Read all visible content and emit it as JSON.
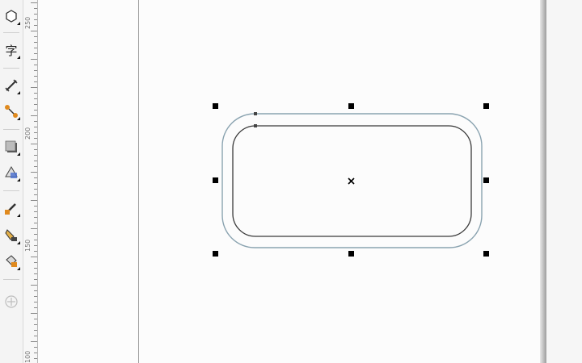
{
  "toolbox": {
    "tools": [
      {
        "name": "polygon-tool",
        "icon": "polygon-icon"
      },
      {
        "name": "text-tool",
        "icon": "text-icon",
        "glyph": "字"
      },
      {
        "name": "dimension-tool",
        "icon": "dimension-icon"
      },
      {
        "name": "connector-tool",
        "icon": "connector-icon"
      },
      {
        "name": "shadow-tool",
        "icon": "drop-shadow-icon"
      },
      {
        "name": "transparency-tool",
        "icon": "transparency-icon"
      },
      {
        "name": "eyedropper-tool",
        "icon": "eyedropper-icon"
      },
      {
        "name": "outline-tool",
        "icon": "outline-pen-icon"
      },
      {
        "name": "fill-tool",
        "icon": "fill-bucket-icon"
      },
      {
        "name": "add-tool",
        "icon": "plus-circle-icon"
      }
    ]
  },
  "ruler": {
    "labels": [
      "250",
      "200",
      "150",
      "100"
    ]
  },
  "canvas": {
    "selected_object": "rounded-rectangle-with-contour",
    "colors": {
      "outer_outline": "#8aa3b0",
      "inner_outline": "#3a3a3a",
      "handle": "#000000",
      "page_border": "#9a9a9a"
    }
  }
}
